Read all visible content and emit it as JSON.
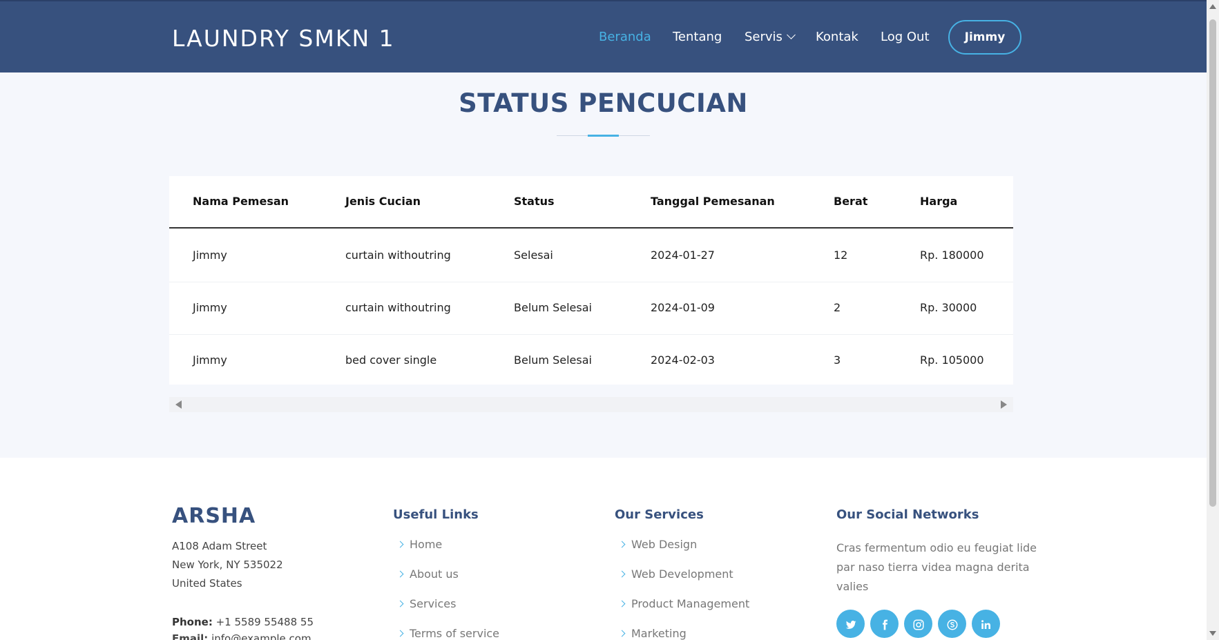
{
  "header": {
    "logo": "LAUNDRY SMKN 1",
    "nav": [
      "Beranda",
      "Tentang",
      "Servis",
      "Kontak",
      "Log Out"
    ],
    "active_nav": "Beranda",
    "user_button": "Jimmy"
  },
  "main": {
    "title": "STATUS PENCUCIAN",
    "table": {
      "headers": [
        "Nama Pemesan",
        "Jenis Cucian",
        "Status",
        "Tanggal Pemesanan",
        "Berat",
        "Harga"
      ],
      "rows": [
        [
          "Jimmy",
          "curtain withoutring",
          "Selesai",
          "2024-01-27",
          "12",
          "Rp. 180000"
        ],
        [
          "Jimmy",
          "curtain withoutring",
          "Belum Selesai",
          "2024-01-09",
          "2",
          "Rp. 30000"
        ],
        [
          "Jimmy",
          "bed cover single",
          "Belum Selesai",
          "2024-02-03",
          "3",
          "Rp. 105000"
        ]
      ]
    }
  },
  "footer": {
    "brand": "ARSHA",
    "address": [
      "A108 Adam Street",
      "New York, NY 535022",
      "United States"
    ],
    "phone_label": "Phone:",
    "phone": "+1 5589 55488 55",
    "email_label": "Email:",
    "email": "info@example.com",
    "useful_links": {
      "title": "Useful Links",
      "items": [
        "Home",
        "About us",
        "Services",
        "Terms of service"
      ]
    },
    "services": {
      "title": "Our Services",
      "items": [
        "Web Design",
        "Web Development",
        "Product Management",
        "Marketing"
      ]
    },
    "social": {
      "title": "Our Social Networks",
      "text": "Cras fermentum odio eu feugiat lide par naso tierra videa magna derita valies",
      "icons": [
        "twitter-icon",
        "facebook-icon",
        "instagram-icon",
        "skype-icon",
        "linkedin-icon"
      ]
    }
  },
  "colors": {
    "header_bg": "#37517e",
    "accent": "#47b2e4",
    "page_bg": "#f5f7fc"
  }
}
